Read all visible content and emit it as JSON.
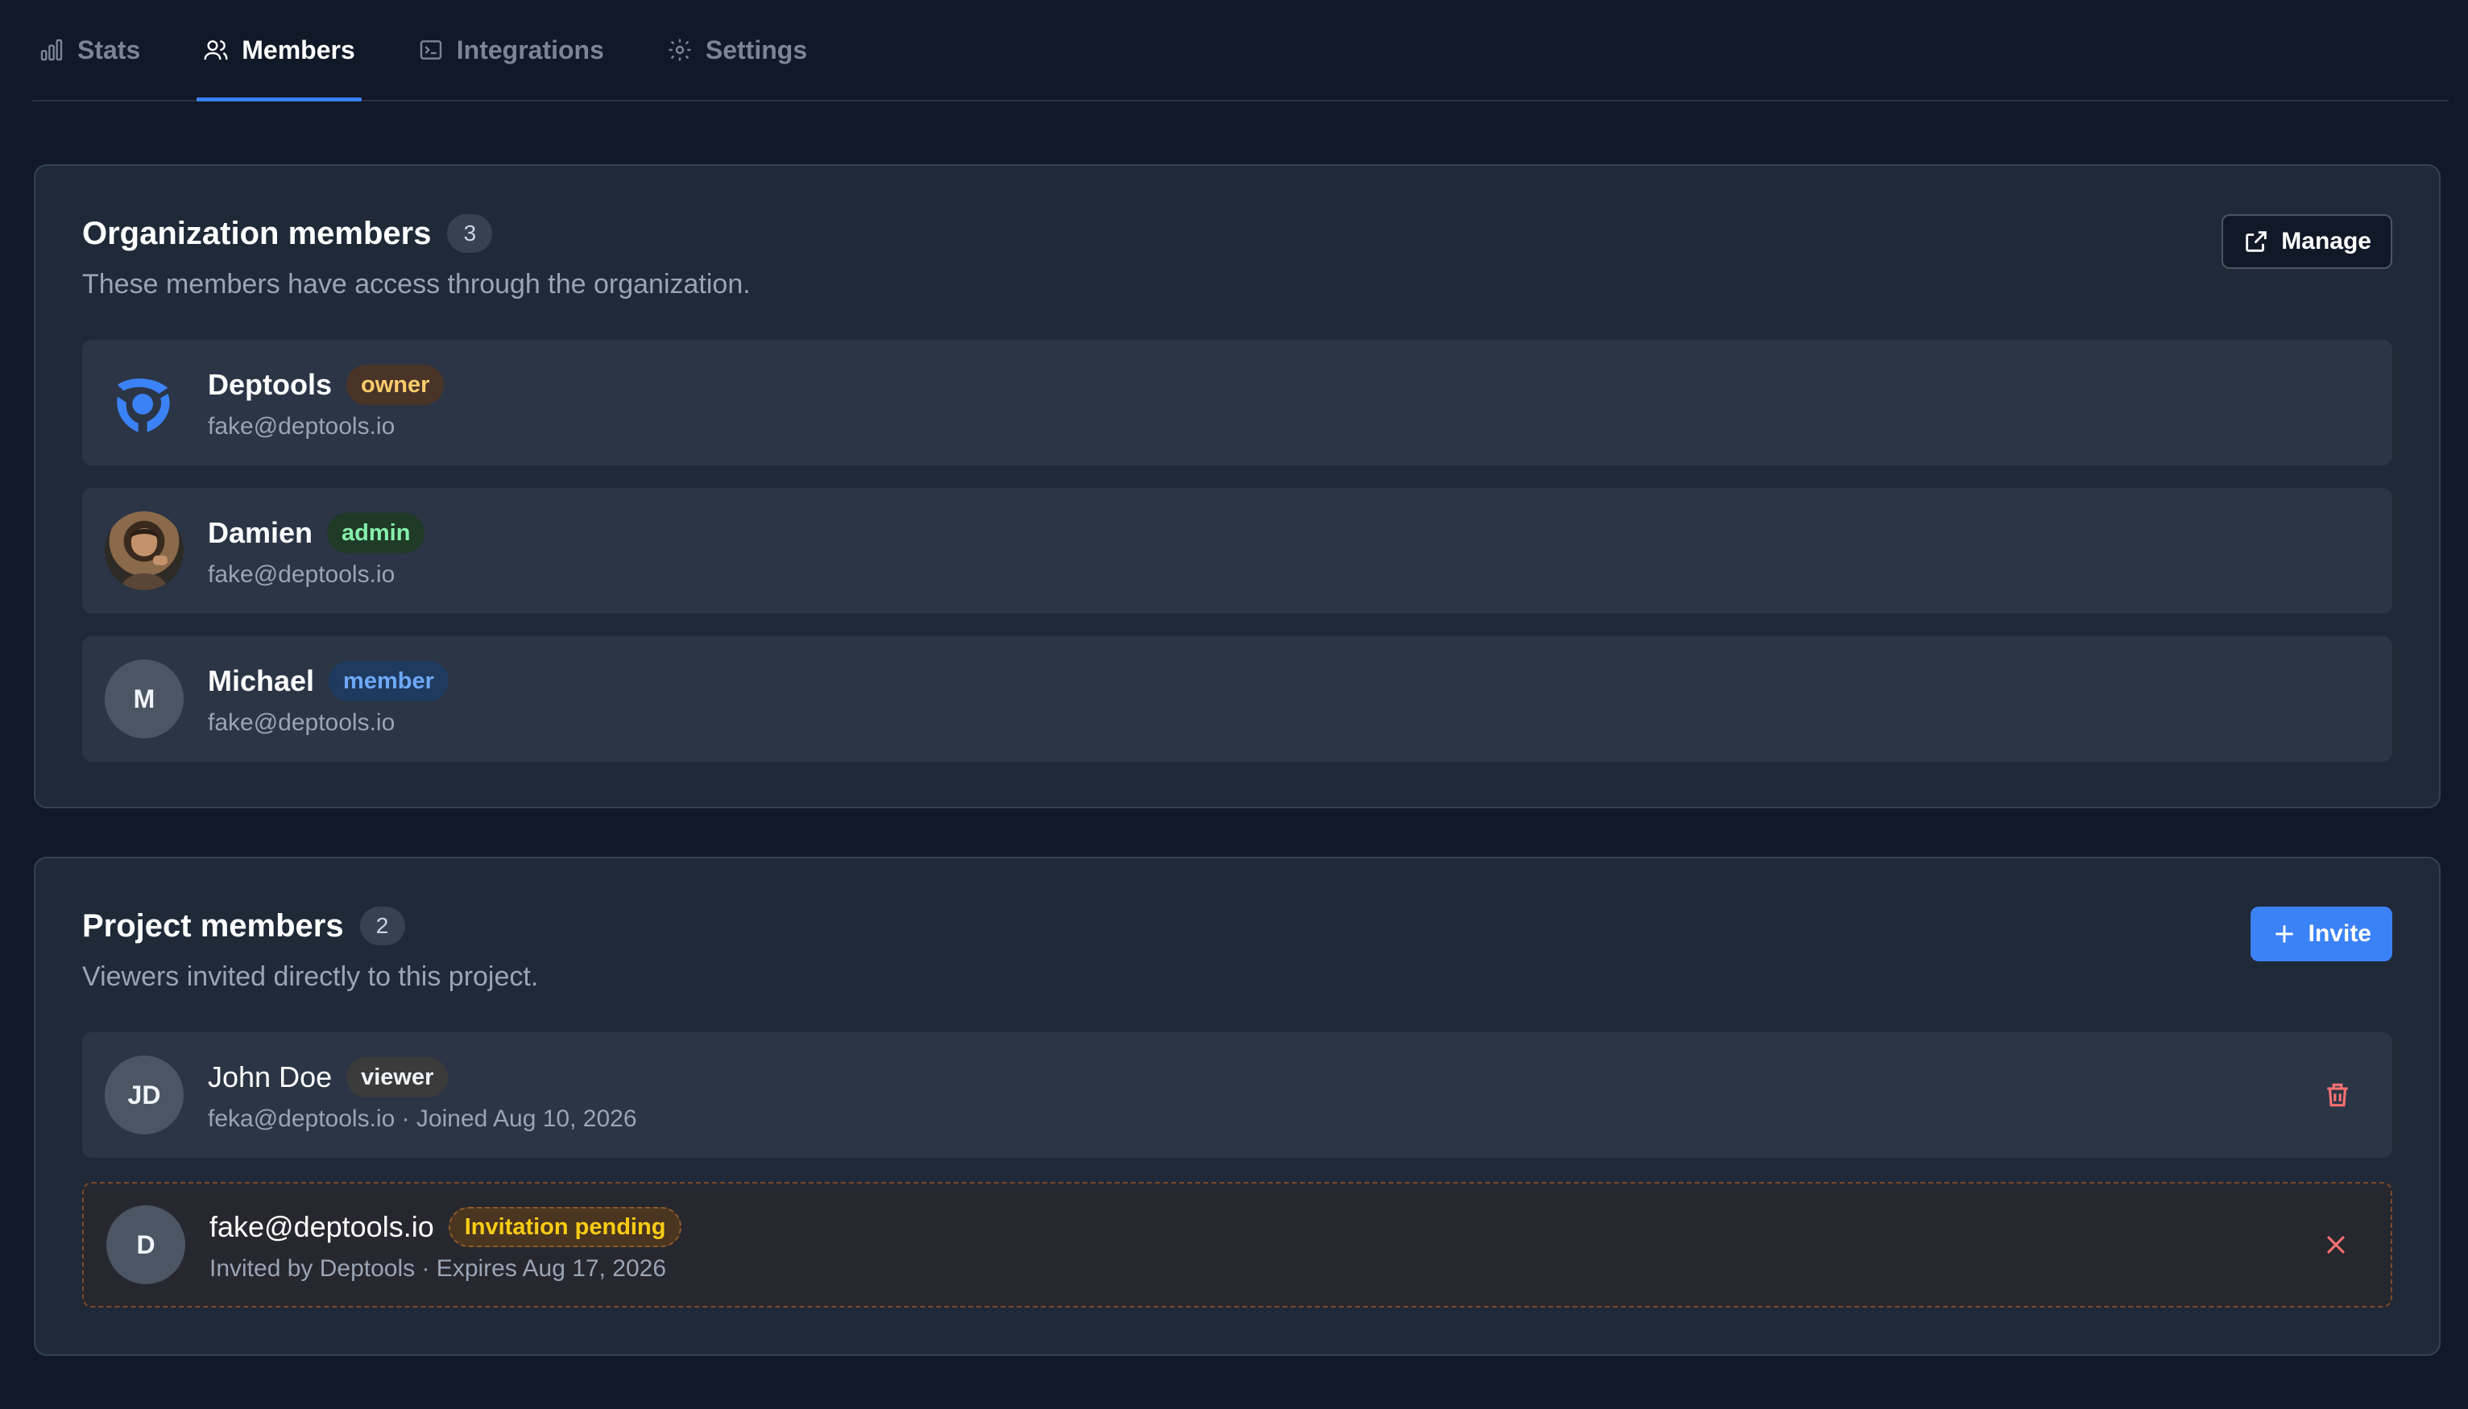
{
  "tabs": [
    {
      "label": "Stats",
      "icon": "bar-chart-icon",
      "active": false
    },
    {
      "label": "Members",
      "icon": "users-icon",
      "active": true
    },
    {
      "label": "Integrations",
      "icon": "terminal-icon",
      "active": false
    },
    {
      "label": "Settings",
      "icon": "gear-icon",
      "active": false
    }
  ],
  "org": {
    "title": "Organization members",
    "count": "3",
    "subtitle": "These members have access through the organization.",
    "manage_label": "Manage",
    "members": [
      {
        "name": "Deptools",
        "role": "owner",
        "email": "fake@deptools.io",
        "avatar": "deptools-logo"
      },
      {
        "name": "Damien",
        "role": "admin",
        "email": "fake@deptools.io",
        "avatar": "photo"
      },
      {
        "name": "Michael",
        "role": "member",
        "email": "fake@deptools.io",
        "initials": "M"
      }
    ]
  },
  "project": {
    "title": "Project members",
    "count": "2",
    "subtitle": "Viewers invited directly to this project.",
    "invite_label": "Invite",
    "members": [
      {
        "initials": "JD",
        "name": "John Doe",
        "role": "viewer",
        "meta": "feka@deptools.io · Joined Aug 10, 2026"
      },
      {
        "initials": "D",
        "name": "fake@deptools.io",
        "role": "Invitation pending",
        "meta": "Invited by Deptools · Expires Aug 17, 2026"
      }
    ]
  },
  "colors": {
    "accent": "#3b82f6",
    "danger": "#f87171",
    "background": "#111827"
  }
}
